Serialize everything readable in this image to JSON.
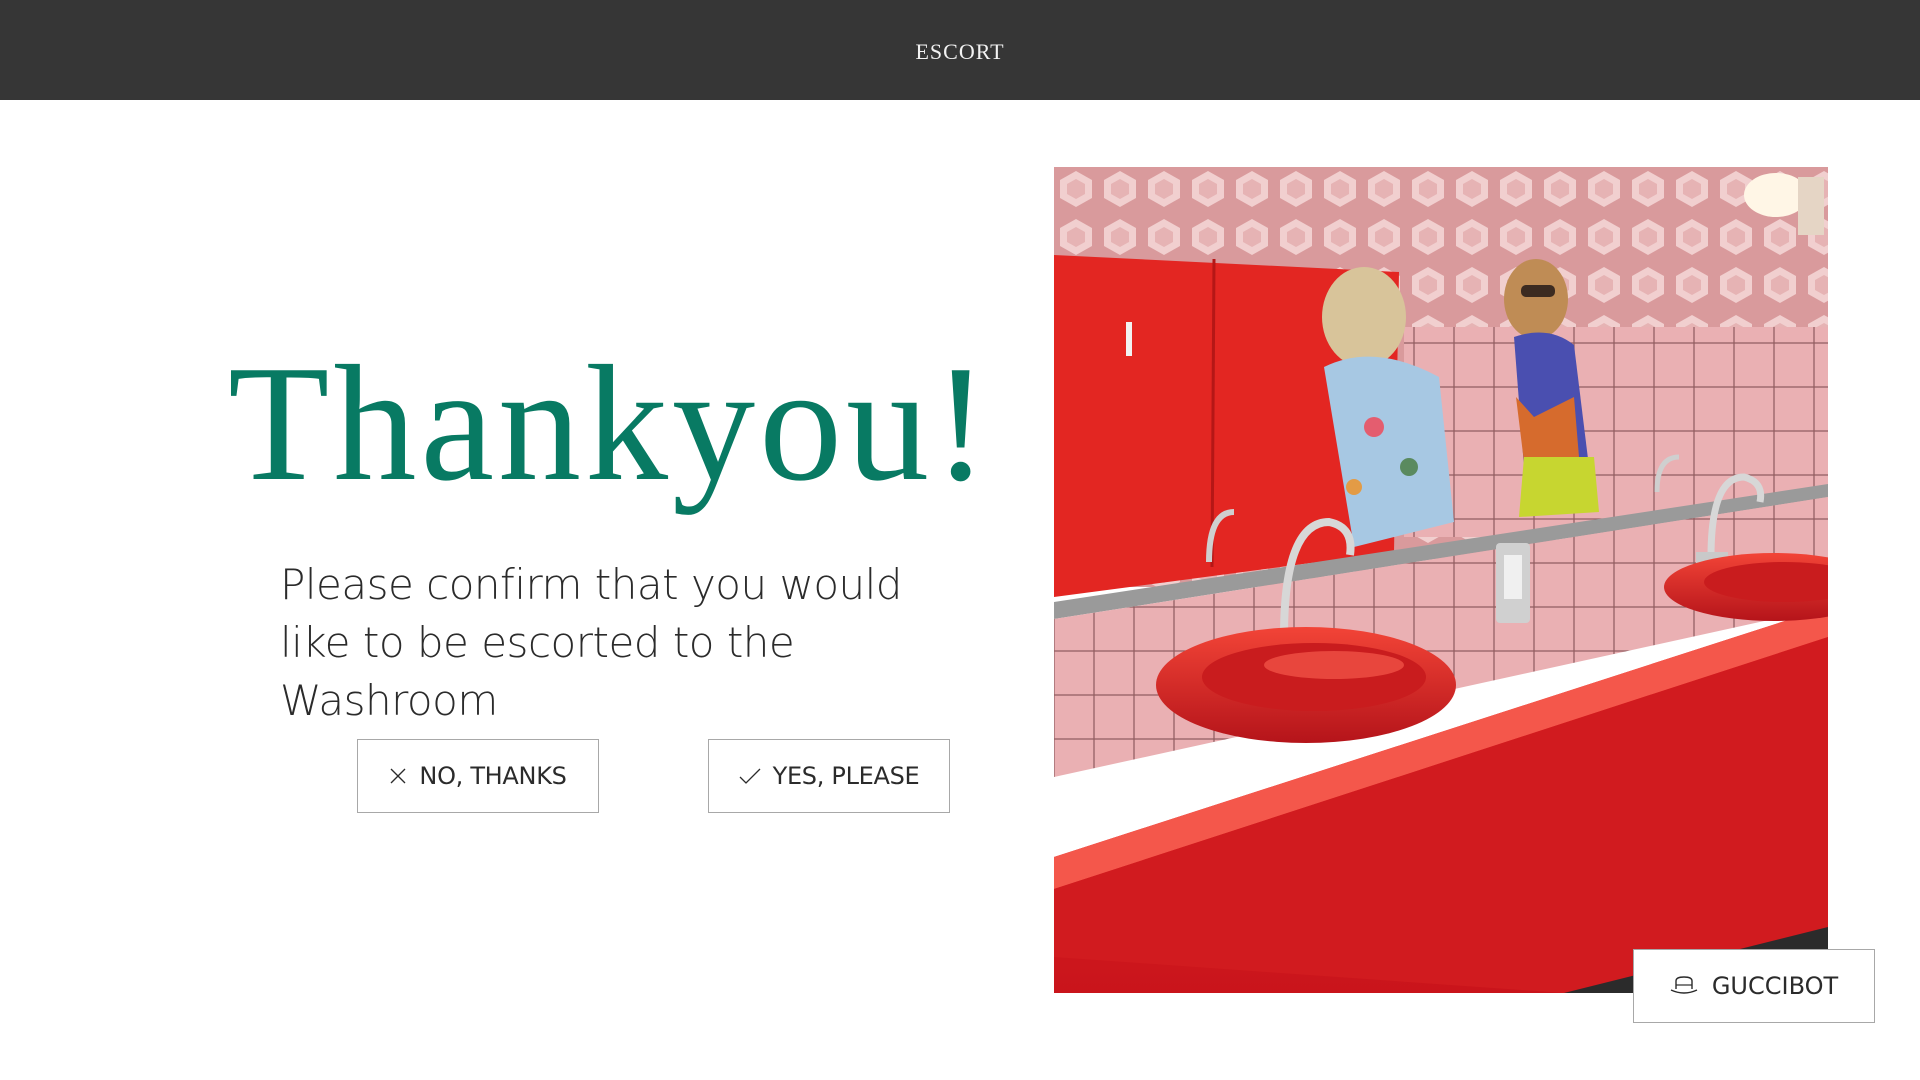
{
  "header": {
    "title": "ESCORT"
  },
  "main": {
    "headline": "Thankyou!",
    "message": "Please confirm that you would like to be escorted to the Washroom",
    "buttons": {
      "no_label": "NO, THANKS",
      "yes_label": "YES, PLEASE"
    },
    "photo_alt": "Washroom"
  },
  "assistant": {
    "label": "GUCCIBOT",
    "icon": "robot-hat-icon"
  },
  "colors": {
    "header_bg": "#363636",
    "headline": "#087a63",
    "counter_red": "#e3201f",
    "tile_pink": "#e9a4a8"
  }
}
